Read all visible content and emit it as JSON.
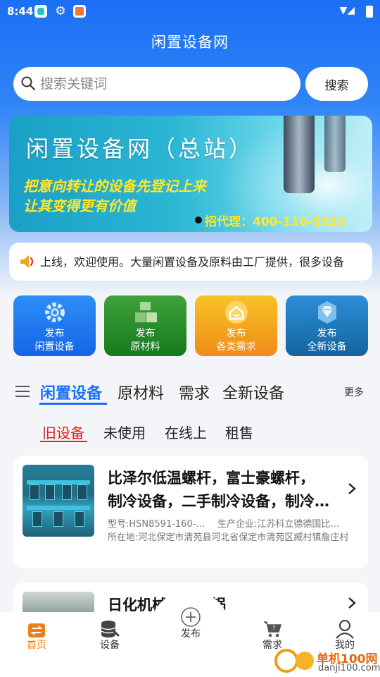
{
  "status_bar": {
    "time": "8:44"
  },
  "header": {
    "title": "闲置设备网"
  },
  "search": {
    "placeholder": "搜索关键词",
    "button_label": "搜索"
  },
  "banner": {
    "title": "闲置设备网（总站）",
    "line1": "把意向转让的设备先登记上来",
    "line2": "让其变得更有价值",
    "phone": "招代理：400-110-5533"
  },
  "notice": {
    "text": "上线，欢迎使用。大量闲置设备及原料由工厂提供，很多设备"
  },
  "quick_actions": [
    {
      "line1": "发布",
      "line2": "闲置设备",
      "icon": "gear-icon"
    },
    {
      "line1": "发布",
      "line2": "原材料",
      "icon": "boxes-icon"
    },
    {
      "line1": "发布",
      "line2": "各类需求",
      "icon": "home-badge-icon"
    },
    {
      "line1": "发布",
      "line2": "全新设备",
      "icon": "diamond-badge-icon"
    }
  ],
  "category_tabs": {
    "items": [
      "闲置设备",
      "原材料",
      "需求",
      "全新设备"
    ],
    "active": "闲置设备",
    "more": "更多"
  },
  "sub_tabs": {
    "items": [
      "旧设备",
      "未使用",
      "在线上",
      "租售"
    ],
    "active": "旧设备"
  },
  "listings": [
    {
      "title_line1": "比泽尔低温螺杆，富士豪螺杆，",
      "title_line2": "制冷设备，二手制冷设备，制冷…",
      "model": "型号:HSN8591-160-…",
      "company": "生产企业:江苏科立德德国比…",
      "location": "所在地:河北保定市清苑县河北省保定市清苑区臧村镇詹庄村"
    },
    {
      "title_line1": "日化机械设备单锅"
    }
  ],
  "bottom_nav": {
    "home": "首页",
    "equipment": "设备",
    "publish": "发布",
    "demand": "需求",
    "mine": "我的"
  },
  "watermark": {
    "brand": "单机100网",
    "url": "danji100.com"
  },
  "colors": {
    "primary": "#1b6ff5",
    "active_nav": "#ee7f16",
    "sub_tab_active": "#e0201a",
    "banner_text": "#ffe72a"
  }
}
